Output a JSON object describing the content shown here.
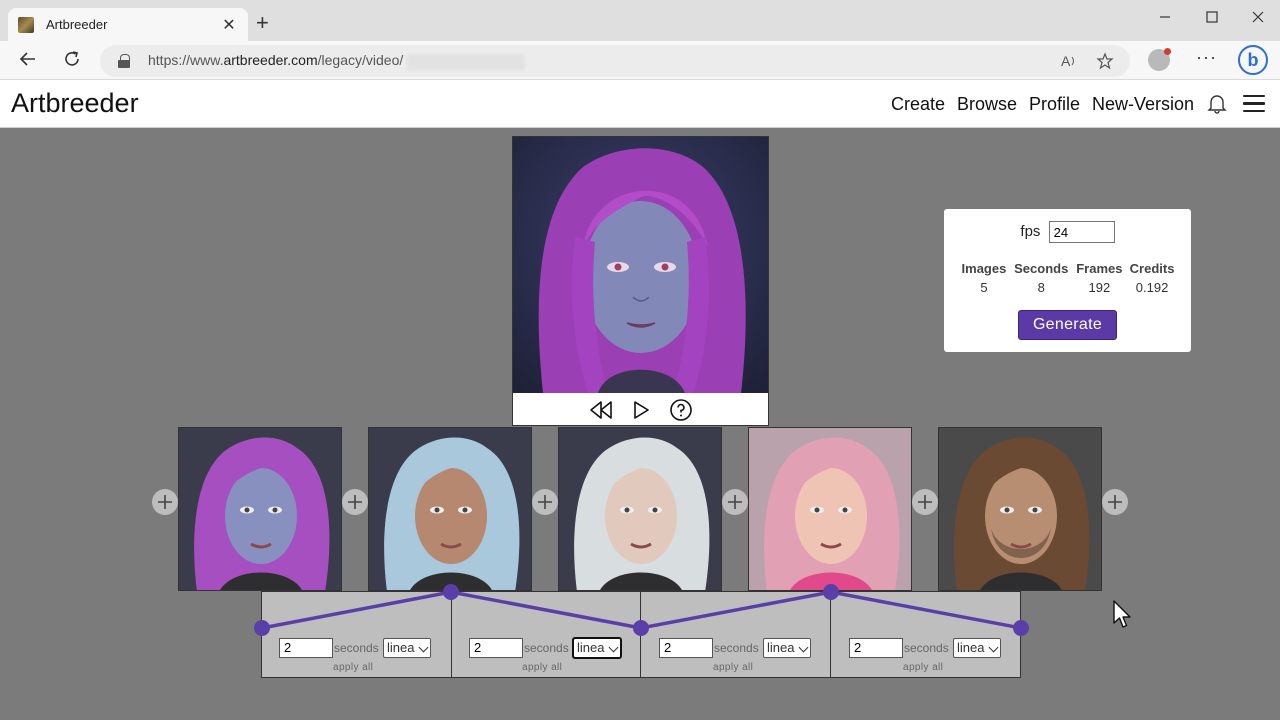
{
  "browser": {
    "tab_title": "Artbreeder",
    "url_prefix": "https://www.",
    "url_domain": "artbreeder.com",
    "url_path": "/legacy/video/",
    "new_tab_label": "+",
    "close_tab_label": "✕"
  },
  "site": {
    "logo": "Artbreeder",
    "nav": [
      "Create",
      "Browse",
      "Profile",
      "New-Version"
    ]
  },
  "info": {
    "fps_label": "fps",
    "fps_value": "24",
    "headers": [
      "Images",
      "Seconds",
      "Frames",
      "Credits"
    ],
    "values": [
      "5",
      "8",
      "192",
      "0.192"
    ],
    "generate_label": "Generate"
  },
  "thumbnails": [
    {
      "name": "purple-hair-woman",
      "hair": "#a64fc0",
      "skin": "#8890c0"
    },
    {
      "name": "blue-hair-boy",
      "hair": "#a9c8dc",
      "skin": "#b68870"
    },
    {
      "name": "silver-hair-woman",
      "hair": "#d8dde0",
      "skin": "#e2c9bd"
    },
    {
      "name": "pink-hair-girl",
      "hair": "#e2a0b4",
      "skin": "#f0c4b4"
    },
    {
      "name": "bearded-man",
      "hair": "#6a4a33",
      "skin": "#b88e72"
    }
  ],
  "segments": [
    {
      "seconds": "2",
      "seconds_label": "seconds",
      "interp": "linea",
      "apply": "apply all",
      "focused": false
    },
    {
      "seconds": "2",
      "seconds_label": "seconds",
      "interp": "linea",
      "apply": "apply all",
      "focused": true
    },
    {
      "seconds": "2",
      "seconds_label": "seconds",
      "interp": "linea",
      "apply": "apply all",
      "focused": false
    },
    {
      "seconds": "2",
      "seconds_label": "seconds",
      "interp": "linea",
      "apply": "apply all",
      "focused": false
    }
  ],
  "colors": {
    "accent": "#5b3aa5",
    "curve": "#5a3fa8",
    "page_bg": "#7b7b7b"
  }
}
